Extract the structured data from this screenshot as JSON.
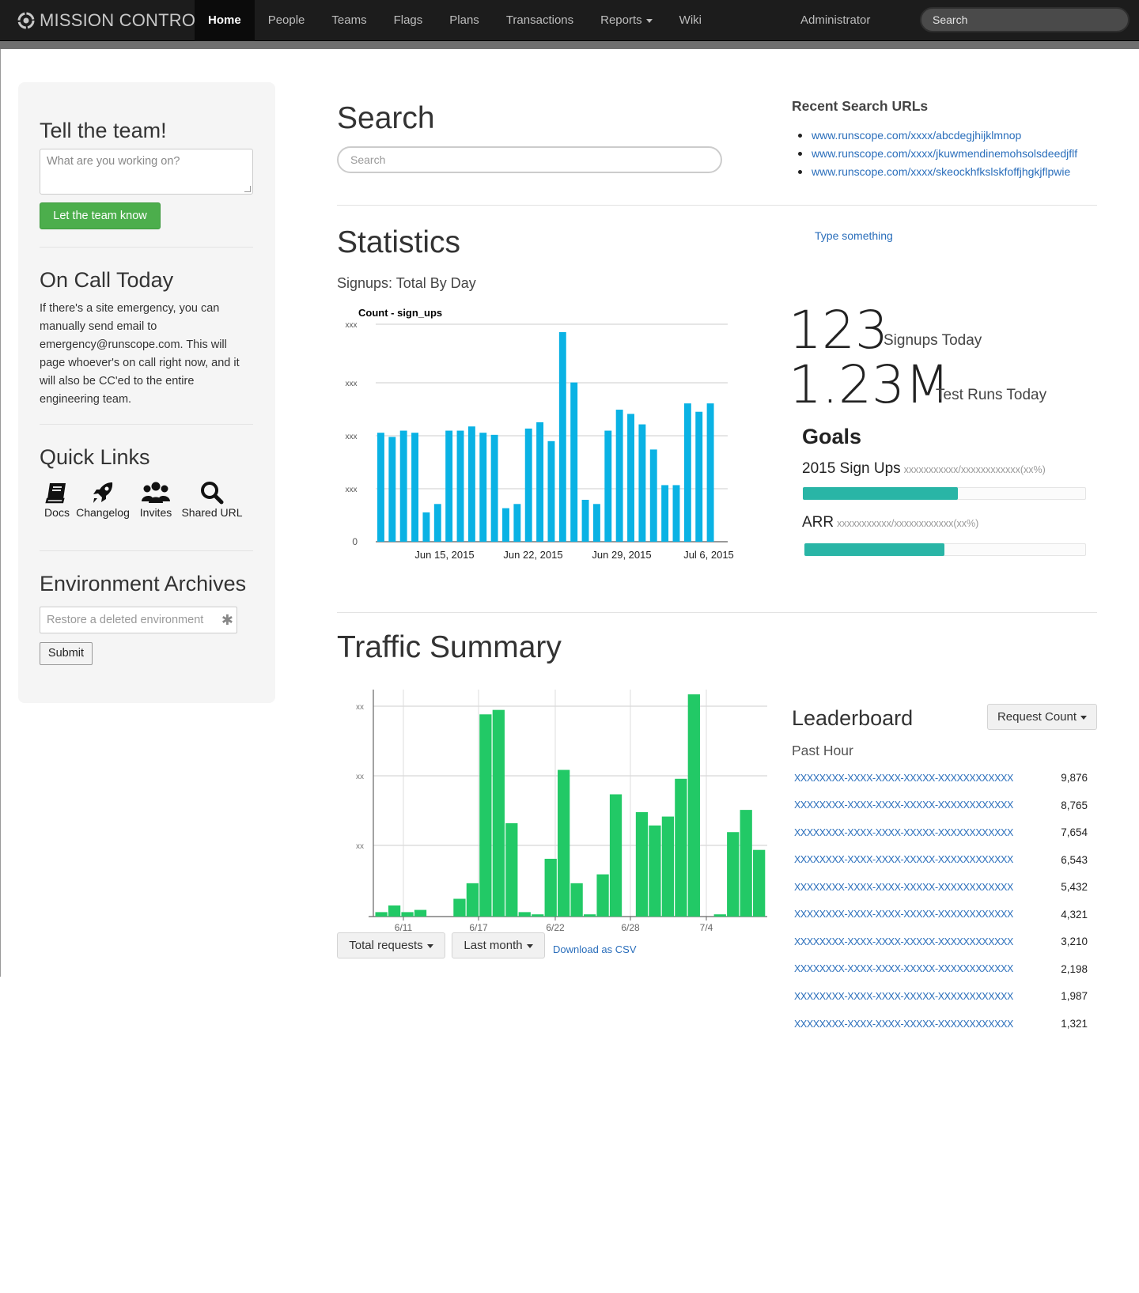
{
  "app": {
    "brand": "MISSION CONTROL",
    "nav": [
      "Home",
      "People",
      "Teams",
      "Flags",
      "Plans",
      "Transactions",
      "Reports",
      "Wiki"
    ],
    "user": "Administrator",
    "search_placeholder": "Search"
  },
  "sidebar": {
    "tell_title": "Tell the team!",
    "tell_placeholder": "What are you working on?",
    "tell_button": "Let the team know",
    "oncall_title": "On Call Today",
    "oncall_text": "If there's a site emergency, you can manually send email to emergency@runscope.com. This will page whoever's on call right now, and it will also be CC'ed to the entire engineering team.",
    "quicklinks_title": "Quick Links",
    "quicklinks": [
      "Docs",
      "Changelog",
      "Invites",
      "Shared URL"
    ],
    "archives_title": "Environment Archives",
    "archives_placeholder": "Restore a deleted environment",
    "archives_button": "Submit"
  },
  "search": {
    "title": "Search",
    "placeholder": "Search",
    "recent_title": "Recent Search URLs",
    "recent": [
      "www.runscope.com/xxxx/abcdegjhijklmnop",
      "www.runscope.com/xxxx/jkuwmendinemohsolsdeedjflf",
      "www.runscope.com/xxxx/skeockhfkslskfoffjhgkjflpwie"
    ]
  },
  "statistics": {
    "title": "Statistics",
    "type_link": "Type something",
    "chart_subtitle": "Signups: Total By Day",
    "signups_value": "123",
    "signups_label": "Signups Today",
    "testruns_value": "1.23M",
    "testruns_label": "Test Runs Today",
    "goals_title": "Goals",
    "goals": [
      {
        "label": "2015 Sign Ups",
        "sub": "xxxxxxxxxxx/xxxxxxxxxxxx(xx%)",
        "progress": 0.55
      },
      {
        "label": "ARR",
        "sub": "xxxxxxxxxxx/xxxxxxxxxxxx(xx%)",
        "progress": 0.5
      }
    ]
  },
  "traffic": {
    "title": "Traffic Summary",
    "total_requests": "Total requests",
    "last_month": "Last month",
    "csv_link": "Download as CSV",
    "leaderboard_title": "Leaderboard",
    "leaderboard_button": "Request Count",
    "leaderboard_period": "Past Hour",
    "leaderboard": [
      {
        "key": "XXXXXXXX-XXXX-XXXX-XXXXX-XXXXXXXXXXXX",
        "value": "9,876"
      },
      {
        "key": "XXXXXXXX-XXXX-XXXX-XXXXX-XXXXXXXXXXXX",
        "value": "8,765"
      },
      {
        "key": "XXXXXXXX-XXXX-XXXX-XXXXX-XXXXXXXXXXXX",
        "value": "7,654"
      },
      {
        "key": "XXXXXXXX-XXXX-XXXX-XXXXX-XXXXXXXXXXXX",
        "value": "6,543"
      },
      {
        "key": "XXXXXXXX-XXXX-XXXX-XXXXX-XXXXXXXXXXXX",
        "value": "5,432"
      },
      {
        "key": "XXXXXXXX-XXXX-XXXX-XXXXX-XXXXXXXXXXXX",
        "value": "4,321"
      },
      {
        "key": "XXXXXXXX-XXXX-XXXX-XXXXX-XXXXXXXXXXXX",
        "value": "3,210"
      },
      {
        "key": "XXXXXXXX-XXXX-XXXX-XXXXX-XXXXXXXXXXXX",
        "value": "2,198"
      },
      {
        "key": "XXXXXXXX-XXXX-XXXX-XXXXX-XXXXXXXXXXXX",
        "value": "1,987"
      },
      {
        "key": "XXXXXXXX-XXXX-XXXX-XXXXX-XXXXXXXXXXXX",
        "value": "1,321"
      }
    ]
  },
  "colors": {
    "signups_bar": "#0ab2e4",
    "traffic_bar": "#22c966",
    "goal_bar": "#29b5a6",
    "link": "#2a6ebb",
    "button_green": "#4cae4c"
  },
  "chart_data": [
    {
      "type": "bar",
      "title": "Count - sign_ups",
      "y_tick_labels": [
        "0",
        "xxx",
        "xxx",
        "xxx",
        "xxx"
      ],
      "x_tick_labels": [
        "Jun 15, 2015",
        "Jun 22, 2015",
        "Jun 29, 2015",
        "Jul 6, 2015"
      ],
      "ylim": [
        0,
        100
      ],
      "grid": true,
      "series": [
        {
          "values": [
            52,
            50,
            53,
            52,
            14,
            18,
            53,
            53,
            55,
            52,
            51,
            16,
            18,
            54,
            57,
            48,
            100,
            76,
            20,
            18,
            53,
            63,
            61,
            56,
            44,
            27,
            27,
            66,
            62,
            66
          ]
        }
      ]
    },
    {
      "type": "bar",
      "x_tick_labels": [
        "6/11",
        "6/17",
        "6/22",
        "6/28",
        "7/4"
      ],
      "y_tick_labels": [
        "xx",
        "xx",
        "xx"
      ],
      "ylim": [
        0,
        100
      ],
      "grid": true,
      "series": [
        {
          "values": [
            2,
            5,
            2,
            3,
            0,
            0,
            8,
            15,
            91,
            93,
            42,
            2,
            1,
            26,
            66,
            15,
            1,
            19,
            55,
            0,
            47,
            41,
            45,
            62,
            100,
            0,
            1,
            38,
            48,
            30
          ]
        }
      ]
    }
  ]
}
